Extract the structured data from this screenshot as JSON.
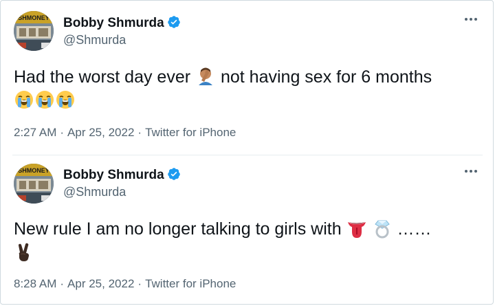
{
  "tweets": [
    {
      "author": {
        "name": "Bobby Shmurda",
        "handle": "@Shmurda",
        "verified": true,
        "avatar_badge": "SHMONEY",
        "avatar_icon": "shmoney-avatar-icon"
      },
      "text_before": "Had the worst day ever",
      "emoji_1": "facepalm-emoji",
      "text_after": "not having sex for 6 months",
      "emoji_line": [
        "crying-face-emoji",
        "crying-face-emoji",
        "crying-face-emoji"
      ],
      "time": "2:27 AM",
      "date": "Apr 25, 2022",
      "source": "Twitter for iPhone",
      "more_icon": "more-options-icon"
    },
    {
      "author": {
        "name": "Bobby Shmurda",
        "handle": "@Shmurda",
        "verified": true,
        "avatar_badge": "SHMONEY",
        "avatar_icon": "shmoney-avatar-icon"
      },
      "text_before": "New rule I am no longer talking to girls with",
      "emoji_1": "tongue-emoji",
      "emoji_2": "ring-emoji",
      "text_after": "……",
      "emoji_line": [
        "victory-hand-emoji"
      ],
      "time": "8:28 AM",
      "date": "Apr 25, 2022",
      "source": "Twitter for iPhone",
      "more_icon": "more-options-icon"
    }
  ],
  "separator": "·",
  "colors": {
    "text": "#0f1419",
    "secondary": "#536471",
    "verified": "#1d9bf0",
    "border": "#cfd9de"
  }
}
